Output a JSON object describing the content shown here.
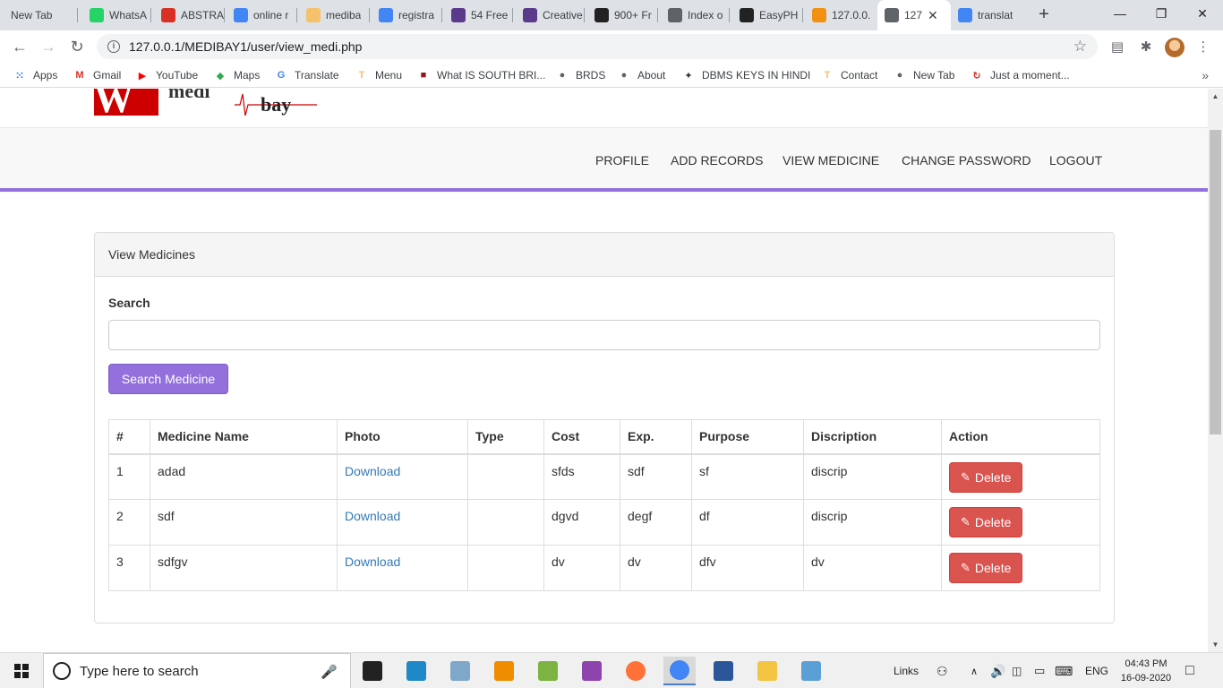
{
  "browser": {
    "tabs": [
      {
        "label": "New Tab",
        "icon": "newtab",
        "color": "#dee1e6"
      },
      {
        "label": "WhatsA",
        "icon": "whatsapp",
        "color": "#25d366"
      },
      {
        "label": "ABSTRA",
        "icon": "gmail",
        "color": "#d93025"
      },
      {
        "label": "online r",
        "icon": "google",
        "color": "#4285f4"
      },
      {
        "label": "mediba",
        "icon": "medibay",
        "color": "#f5c26b"
      },
      {
        "label": "registra",
        "icon": "google",
        "color": "#4285f4"
      },
      {
        "label": "54 Free",
        "icon": "colorlib",
        "color": "#5b3a8c"
      },
      {
        "label": "Creative",
        "icon": "colorlib",
        "color": "#5b3a8c"
      },
      {
        "label": "900+ Fr",
        "icon": "w3",
        "color": "#222"
      },
      {
        "label": "Index o",
        "icon": "globe",
        "color": "#5f6368"
      },
      {
        "label": "EasyPH",
        "icon": "easyphp",
        "color": "#222"
      },
      {
        "label": "127.0.0.",
        "icon": "phpmyadmin",
        "color": "#f29111"
      },
      {
        "label": "127",
        "icon": "globe",
        "color": "#5f6368",
        "active": true
      },
      {
        "label": "translat",
        "icon": "google",
        "color": "#4285f4"
      }
    ],
    "url": "127.0.0.1/MEDIBAY1/user/view_medi.php",
    "bookmarks": [
      {
        "label": "Apps",
        "icon": "apps-grid",
        "color": "#1a73e8"
      },
      {
        "label": "Gmail",
        "icon": "gmail",
        "color": "#d93025"
      },
      {
        "label": "YouTube",
        "icon": "youtube",
        "color": "#ff0000"
      },
      {
        "label": "Maps",
        "icon": "maps",
        "color": "#34a853"
      },
      {
        "label": "Translate",
        "icon": "translate",
        "color": "#4285f4"
      },
      {
        "label": "Menu",
        "icon": "medibay",
        "color": "#f5c26b"
      },
      {
        "label": "What IS SOUTH BRI...",
        "icon": "site",
        "color": "#8b1a1a"
      },
      {
        "label": "BRDS",
        "icon": "globe",
        "color": "#5f6368"
      },
      {
        "label": "About",
        "icon": "globe",
        "color": "#5f6368"
      },
      {
        "label": "DBMS KEYS IN HINDI",
        "icon": "handshake",
        "color": "#333"
      },
      {
        "label": "Contact",
        "icon": "medibay",
        "color": "#f5c26b"
      },
      {
        "label": "New Tab",
        "icon": "globe",
        "color": "#5f6368"
      },
      {
        "label": "Just a moment...",
        "icon": "loading",
        "color": "#d93025"
      }
    ]
  },
  "site": {
    "logo_text": "bay",
    "nav": [
      "PROFILE",
      "ADD RECORDS",
      "VIEW MEDICINE",
      "CHANGE PASSWORD",
      "LOGOUT"
    ],
    "accent": "#9370db"
  },
  "panel": {
    "heading": "View Medicines",
    "search_label": "Search",
    "search_value": "",
    "search_button": "Search Medicine",
    "columns": [
      "#",
      "Medicine Name",
      "Photo",
      "Type",
      "Cost",
      "Exp.",
      "Purpose",
      "Discription",
      "Action"
    ],
    "rows": [
      {
        "num": "1",
        "name": "adad",
        "photo": "Download",
        "type": "",
        "cost": "sfds",
        "exp": "sdf",
        "purpose": "sf",
        "description": "discrip",
        "action": "Delete"
      },
      {
        "num": "2",
        "name": "sdf",
        "photo": "Download",
        "type": "",
        "cost": "dgvd",
        "exp": "degf",
        "purpose": "df",
        "description": "discrip",
        "action": "Delete"
      },
      {
        "num": "3",
        "name": "sdfgv",
        "photo": "Download",
        "type": "",
        "cost": "dv",
        "exp": "dv",
        "purpose": "dfv",
        "description": "dv",
        "action": "Delete"
      }
    ]
  },
  "taskbar": {
    "search_placeholder": "Type here to search",
    "links_label": "Links",
    "lang": "ENG",
    "time": "04:43 PM",
    "date": "16-09-2020",
    "apps": [
      {
        "name": "task-view",
        "color": "#222"
      },
      {
        "name": "remote-desktop",
        "color": "#1e88c8"
      },
      {
        "name": "notepad-app",
        "color": "#7fa7c9"
      },
      {
        "name": "vlc",
        "color": "#f08c00"
      },
      {
        "name": "notepadpp",
        "color": "#7cb342"
      },
      {
        "name": "winrar",
        "color": "#8e44ad"
      },
      {
        "name": "firefox",
        "color": "#ff7139"
      },
      {
        "name": "chrome",
        "color": "#4285f4",
        "active": true
      },
      {
        "name": "word",
        "color": "#2b579a"
      },
      {
        "name": "file-explorer",
        "color": "#f4c542"
      },
      {
        "name": "paint",
        "color": "#5aa0d6"
      }
    ]
  }
}
